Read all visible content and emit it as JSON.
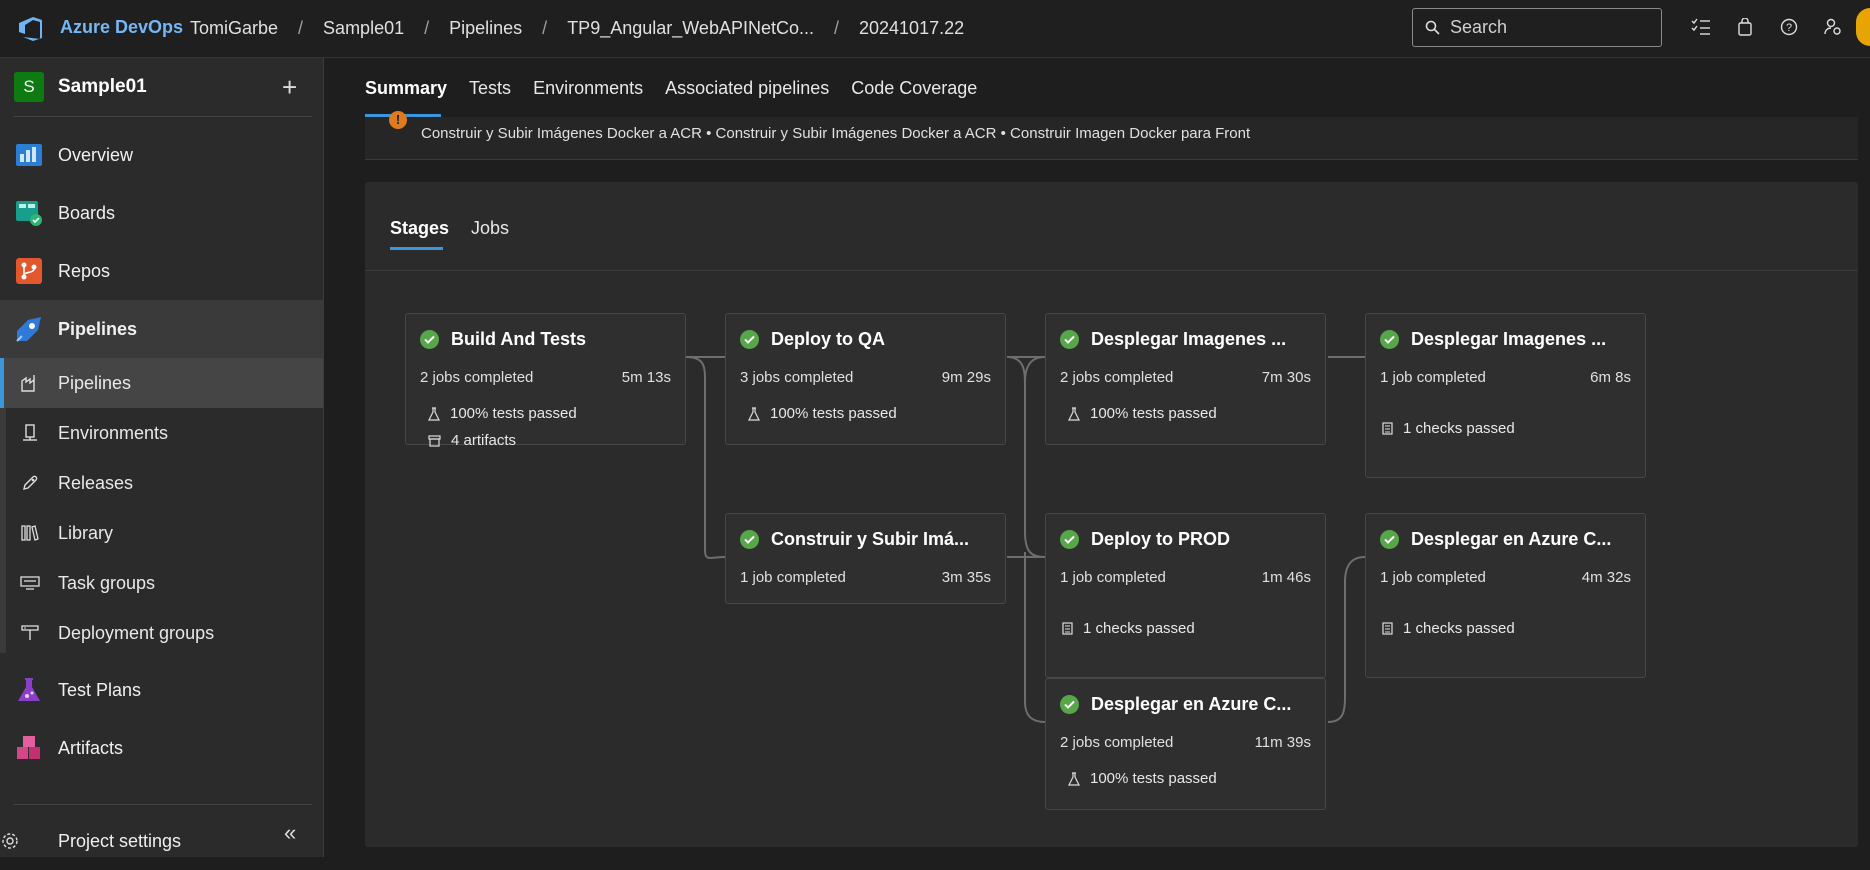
{
  "topbar": {
    "brand": "Azure DevOps",
    "breadcrumbs": [
      "TomiGarbe",
      "Sample01",
      "Pipelines",
      "TP9_Angular_WebAPINetCo...",
      "20241017.22"
    ],
    "search_placeholder": "Search",
    "icons": [
      "task-list-icon",
      "shopping-bag-icon",
      "help-icon",
      "user-settings-icon"
    ]
  },
  "sidebar": {
    "project_initial": "S",
    "project_name": "Sample01",
    "add_symbol": "+",
    "items": [
      {
        "label": "Overview",
        "icon": "overview-icon"
      },
      {
        "label": "Boards",
        "icon": "boards-icon"
      },
      {
        "label": "Repos",
        "icon": "repos-icon"
      },
      {
        "label": "Pipelines",
        "icon": "pipelines-icon"
      }
    ],
    "sub_items": [
      {
        "label": "Pipelines",
        "icon": "pipelines-sub-icon"
      },
      {
        "label": "Environments",
        "icon": "environments-icon"
      },
      {
        "label": "Releases",
        "icon": "releases-icon"
      },
      {
        "label": "Library",
        "icon": "library-icon"
      },
      {
        "label": "Task groups",
        "icon": "task-groups-icon"
      },
      {
        "label": "Deployment groups",
        "icon": "deployment-groups-icon"
      }
    ],
    "bottom_items": [
      {
        "label": "Test Plans",
        "icon": "test-plans-icon"
      },
      {
        "label": "Artifacts",
        "icon": "artifacts-icon"
      }
    ],
    "settings_label": "Project settings",
    "collapse_symbol": "«"
  },
  "main": {
    "tabs": [
      "Summary",
      "Tests",
      "Environments",
      "Associated pipelines",
      "Code Coverage"
    ],
    "warning_text": "Construir y Subir Imágenes Docker a ACR • Construir y Subir Imágenes Docker a ACR • Construir Imagen Docker para Front",
    "panel_tabs": [
      "Stages",
      "Jobs"
    ]
  },
  "stages": [
    {
      "name": "Build And Tests",
      "jobs": "2 jobs completed",
      "duration": "5m 13s",
      "lines": [
        {
          "icon": "flask-icon",
          "text": "100% tests passed"
        },
        {
          "icon": "artifact-box-icon",
          "text": "4 artifacts"
        }
      ]
    },
    {
      "name": "Deploy to QA",
      "jobs": "3 jobs completed",
      "duration": "9m 29s",
      "lines": [
        {
          "icon": "flask-icon",
          "text": "100% tests passed"
        }
      ]
    },
    {
      "name": "Construir y Subir Imá...",
      "jobs": "1 job completed",
      "duration": "3m 35s",
      "lines": []
    },
    {
      "name": "Desplegar Imagenes ...",
      "jobs": "2 jobs completed",
      "duration": "7m 30s",
      "lines": [
        {
          "icon": "flask-icon",
          "text": "100% tests passed"
        }
      ]
    },
    {
      "name": "Deploy to PROD",
      "jobs": "1 job completed",
      "duration": "1m 46s",
      "lines": [
        {
          "icon": "checklist-icon",
          "text": "1 checks passed"
        }
      ]
    },
    {
      "name": "Desplegar en Azure C...",
      "jobs": "2 jobs completed",
      "duration": "11m 39s",
      "lines": [
        {
          "icon": "flask-icon",
          "text": "100% tests passed"
        }
      ]
    },
    {
      "name": "Desplegar Imagenes ...",
      "jobs": "1 job completed",
      "duration": "6m 8s",
      "lines": [
        {
          "icon": "checklist-icon",
          "text": "1 checks passed"
        }
      ]
    },
    {
      "name": "Desplegar en Azure C...",
      "jobs": "1 job completed",
      "duration": "4m 32s",
      "lines": [
        {
          "icon": "checklist-icon",
          "text": "1 checks passed"
        }
      ]
    }
  ],
  "colors": {
    "accent": "#3a96dd",
    "success": "#57a64a",
    "warning": "#e07a1f",
    "brand": "#75b6f5"
  }
}
